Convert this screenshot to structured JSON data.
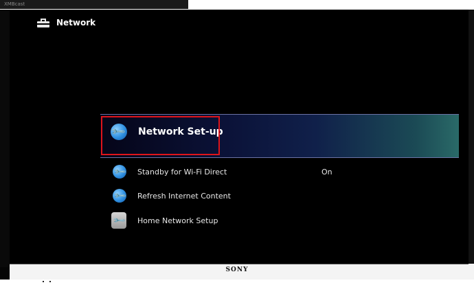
{
  "top_strip": {
    "tiny_text": "XMBcast"
  },
  "category": {
    "label": "Network",
    "icon": "toolbox-icon"
  },
  "menu": {
    "items": [
      {
        "label": "Network Set-up",
        "icon": "wrench-icon",
        "selected": true
      },
      {
        "label": "Standby for Wi-Fi Direct",
        "icon": "wrench-icon",
        "value": "On"
      },
      {
        "label": "Refresh Internet Content",
        "icon": "wrench-icon"
      },
      {
        "label": "Home Network Setup",
        "icon": "home-network-wrench-icon"
      }
    ]
  },
  "brand": {
    "label": "SONY"
  },
  "colors": {
    "highlight_border": "#e0141a",
    "accent_blue": "#2e8fe0"
  }
}
